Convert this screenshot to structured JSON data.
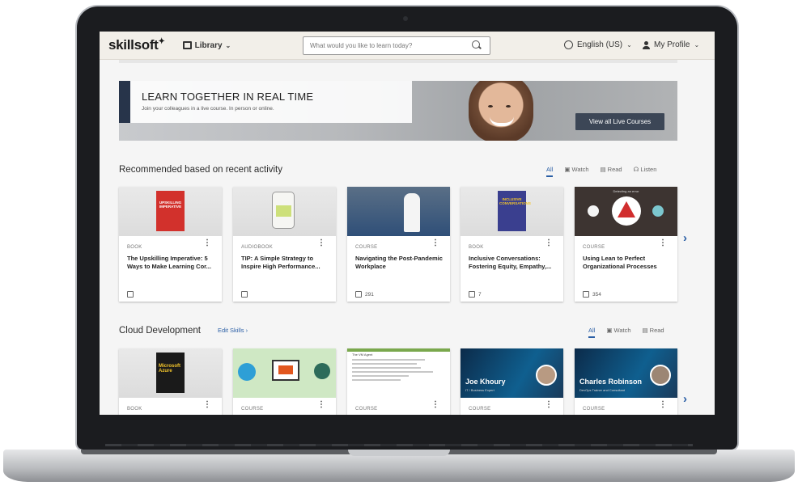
{
  "topbar": {
    "logo": "skillsoft",
    "library_label": "Library",
    "search_placeholder": "What would you like to learn today?",
    "language_label": "English (US)",
    "profile_label": "My Profile"
  },
  "banner": {
    "title": "LEARN TOGETHER IN REAL TIME",
    "subtitle": "Join your colleagues in a live course. In person or online.",
    "button_label": "View all Live Courses"
  },
  "recommended": {
    "title": "Recommended based on recent activity",
    "filters": [
      "All",
      "Watch",
      "Read",
      "Listen"
    ],
    "active_filter": "All",
    "cards": [
      {
        "type": "BOOK",
        "title": "The Upskilling Imperative: 5 Ways to Make Learning Cor...",
        "likes": ""
      },
      {
        "type": "AUDIOBOOK",
        "title": "TIP: A Simple Strategy to Inspire High Performance...",
        "likes": ""
      },
      {
        "type": "COURSE",
        "title": "Navigating the Post-Pandemic Workplace",
        "likes": "291"
      },
      {
        "type": "BOOK",
        "title": "Inclusive Conversations: Fostering Equity, Empathy,...",
        "likes": "7"
      },
      {
        "type": "COURSE",
        "title": "Using Lean to Perfect Organizational Processes",
        "likes": "354"
      }
    ],
    "book_cover_texts": [
      "UPSKILLING IMPERATIVE",
      "INCLUSIVE CONVERSATIONS"
    ],
    "card_image_caption": "Detecting an error"
  },
  "cloud": {
    "title": "Cloud Development",
    "edit_label": "Edit Skills",
    "filters": [
      "All",
      "Watch",
      "Read"
    ],
    "active_filter": "All",
    "cards": [
      {
        "type": "BOOK"
      },
      {
        "type": "COURSE"
      },
      {
        "type": "COURSE",
        "doc_title": "The VM Agent"
      },
      {
        "type": "COURSE",
        "speaker": "Joe Khoury",
        "role": "IT / Business Expert"
      },
      {
        "type": "COURSE",
        "speaker": "Charles Robinson",
        "role": "DevOps Trainer and Consultant"
      }
    ],
    "azure_cover": "Microsoft Azure"
  },
  "colors": {
    "accent": "#2a5ea5",
    "topbar": "#f2efe9",
    "banner_button": "#3c4656"
  }
}
